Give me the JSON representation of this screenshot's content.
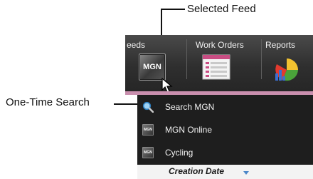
{
  "annotations": {
    "selected_feed": "Selected Feed",
    "one_time_search": "One-Time Search"
  },
  "toolbar": {
    "feeds_label": "eeds",
    "work_orders_label": "Work Orders",
    "reports_label": "Reports",
    "selected_feed_icon_text": "MGN",
    "icons": [
      "mgn-feed-icon",
      "work-orders-icon",
      "reports-icon"
    ]
  },
  "menu": {
    "items": [
      {
        "label": "Search MGN",
        "icon": "search-icon"
      },
      {
        "label": "MGN Online",
        "icon": "mgn-online-icon",
        "icon_text": "MGN"
      },
      {
        "label": "Cycling",
        "icon": "cycling-icon",
        "icon_text": "MGN"
      }
    ]
  },
  "column": {
    "label": "Creation Date",
    "sort_icon": "sort-down-icon"
  },
  "colors": {
    "toolbar_bg": "#333333",
    "menu_bg": "#1e1e1e",
    "accent_pink": "#c98fae",
    "sort_blue": "#4a86c8"
  }
}
